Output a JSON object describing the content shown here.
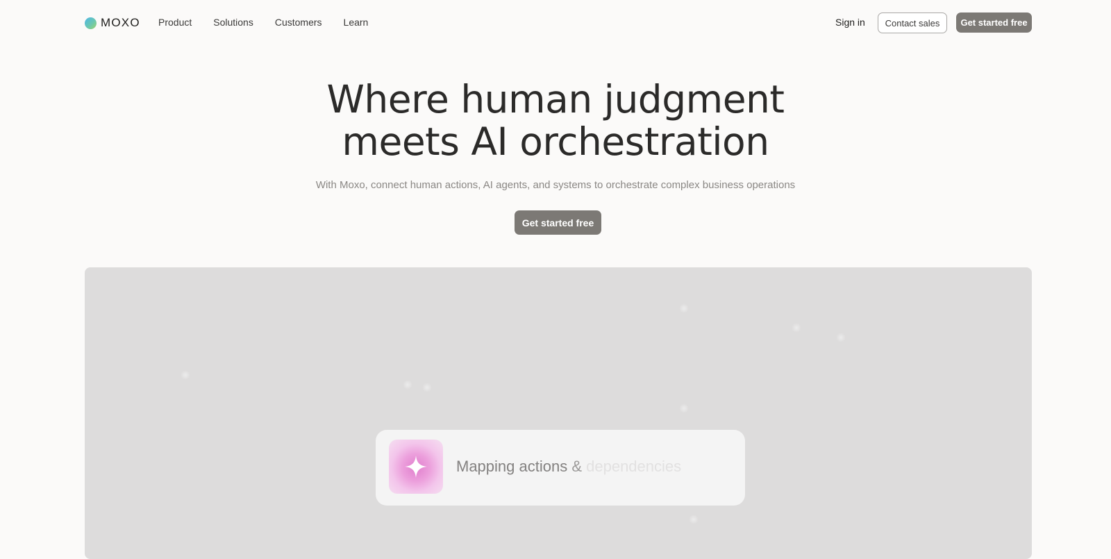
{
  "brand": {
    "name": "MOXO",
    "logo_gradient": [
      "#4db6e8",
      "#6ac7b1",
      "#9ad46e"
    ]
  },
  "nav": {
    "links": [
      "Product",
      "Solutions",
      "Customers",
      "Learn"
    ],
    "sign_in": "Sign in",
    "contact_sales": "Contact sales",
    "cta": "Get started free"
  },
  "hero": {
    "title_line1": "Where human judgment",
    "title_line2": "meets AI orchestration",
    "subtitle": "With Moxo, connect human actions, AI agents, and systems to orchestrate complex business operations",
    "cta": "Get started free"
  },
  "showcase": {
    "status_part1": "Mapping actions",
    "status_part2": " & ",
    "status_part3": "dependencies",
    "icon": "sparkle-icon",
    "accent": "#e07fcd"
  },
  "colors": {
    "button_bg": "#7c7975",
    "page_bg": "#fbfaf9",
    "panel_bg": "#dddcdc"
  }
}
